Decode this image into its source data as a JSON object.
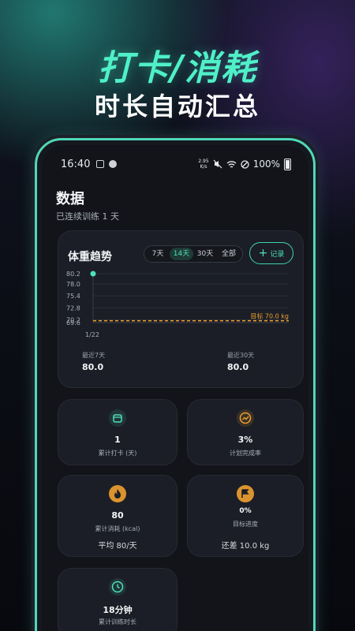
{
  "promo": {
    "title": "打卡/消耗",
    "subtitle": "时长自动汇总"
  },
  "status_bar": {
    "time": "16:40",
    "speed_top": "2.95",
    "speed_bottom": "K/s",
    "battery": "100%"
  },
  "page": {
    "title": "数据",
    "streak": "已连续训练 1 天"
  },
  "weight_card": {
    "title": "体重趋势",
    "ranges": [
      "7天",
      "14天",
      "30天",
      "全部"
    ],
    "active_range": "14天",
    "record_label": "记录",
    "stat_left": {
      "label": "最近7天",
      "value": "80.0"
    },
    "stat_right": {
      "label": "最近30天",
      "value": "80.0"
    }
  },
  "chart_data": {
    "type": "line",
    "yticks": [
      "80.2",
      "78.0",
      "75.4",
      "72.8",
      "70.2",
      "69.6"
    ],
    "ylim": [
      69.6,
      80.2
    ],
    "x": [
      "1/22"
    ],
    "series": [
      {
        "values": [
          80.2
        ]
      }
    ],
    "target": {
      "value": 70.0,
      "label": "目标 70.0 kg"
    }
  },
  "stats": [
    {
      "icon": "calendar-check-icon",
      "value": "1",
      "label": "累计打卡 (天)",
      "extra": ""
    },
    {
      "icon": "trend-up-icon",
      "value": "3%",
      "label": "计划完成率",
      "extra": ""
    },
    {
      "icon": "flame-icon",
      "value": "80",
      "label": "累计消耗 (kcal)",
      "extra": "平均 80/天"
    },
    {
      "icon": "flag-icon",
      "value": "0%",
      "label": "目标进度",
      "extra": "还差 10.0 kg"
    },
    {
      "icon": "clock-icon",
      "value": "18分钟",
      "label": "累计训练时长",
      "extra": ""
    }
  ],
  "colors": {
    "accent": "#4fe0bd",
    "orange": "#f0a030",
    "bg": "#121419",
    "card": "#1b1e26"
  }
}
